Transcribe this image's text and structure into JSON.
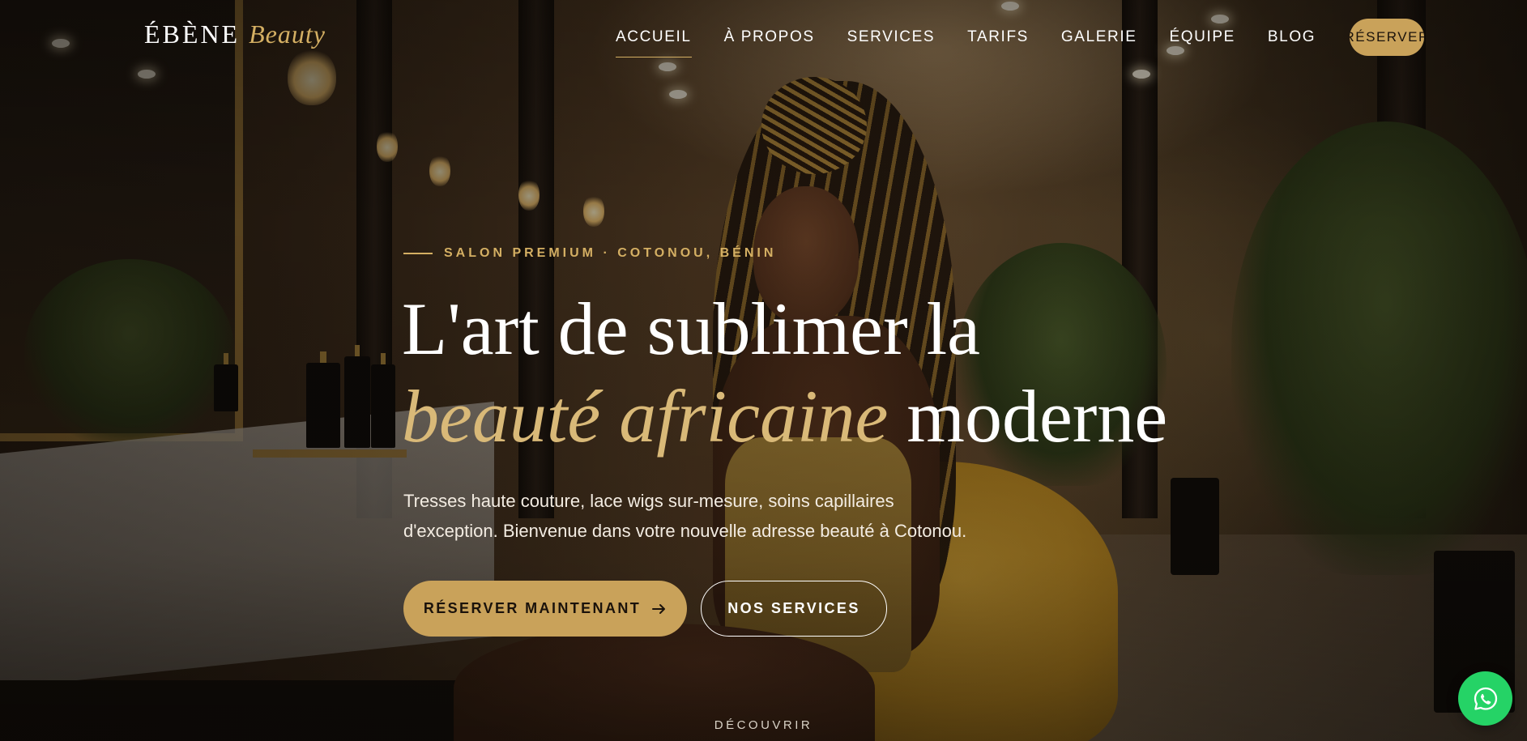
{
  "brand": {
    "name": "ÉBÈNE",
    "accent": "Beauty",
    "accent_color": "#d4af63"
  },
  "nav": {
    "items": [
      {
        "label": "ACCUEIL",
        "active": true
      },
      {
        "label": "À PROPOS",
        "active": false
      },
      {
        "label": "SERVICES",
        "active": false
      },
      {
        "label": "TARIFS",
        "active": false
      },
      {
        "label": "GALERIE",
        "active": false
      },
      {
        "label": "ÉQUIPE",
        "active": false
      },
      {
        "label": "BLOG",
        "active": false
      }
    ],
    "cta_label": "RÉSERVER"
  },
  "hero": {
    "eyebrow": "SALON PREMIUM · COTONOU, BÉNIN",
    "headline_line1": "L'art de sublimer la",
    "headline_italic": "beauté africaine",
    "headline_end": "moderne",
    "lead": "Tresses haute couture, lace wigs sur-mesure, soins capillaires d'exception. Bienvenue dans votre nouvelle adresse beauté à Cotonou.",
    "primary_button": "RÉSERVER MAINTENANT",
    "primary_icon": "arrow-right-icon",
    "secondary_button": "NOS SERVICES",
    "scroll_hint": "DÉCOUVRIR"
  },
  "floating": {
    "whatsapp_icon": "whatsapp-icon",
    "whatsapp_color": "#25d366"
  },
  "colors": {
    "gold": "#c9a25a",
    "text_light": "#ffffff"
  }
}
